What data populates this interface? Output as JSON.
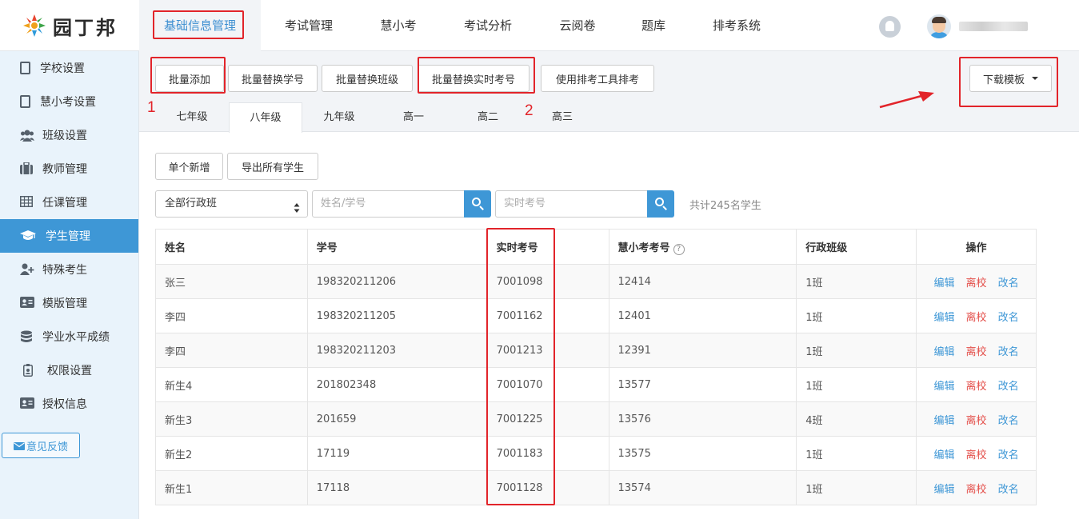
{
  "brand": {
    "name": "园丁邦"
  },
  "topnav": {
    "tabs": [
      {
        "label": "基础信息管理",
        "active": true
      },
      {
        "label": "考试管理"
      },
      {
        "label": "慧小考"
      },
      {
        "label": "考试分析"
      },
      {
        "label": "云阅卷"
      },
      {
        "label": "题库"
      },
      {
        "label": "排考系统"
      }
    ]
  },
  "sidebar": {
    "items": [
      {
        "label": "学校设置",
        "icon": "building-icon"
      },
      {
        "label": "慧小考设置",
        "icon": "building-icon"
      },
      {
        "label": "班级设置",
        "icon": "users-icon"
      },
      {
        "label": "教师管理",
        "icon": "briefcase-icon"
      },
      {
        "label": "任课管理",
        "icon": "table-icon"
      },
      {
        "label": "学生管理",
        "icon": "graduation-cap-icon",
        "active": true
      },
      {
        "label": "特殊考生",
        "icon": "user-plus-icon"
      },
      {
        "label": "模版管理",
        "icon": "id-card-icon"
      },
      {
        "label": "学业水平成绩",
        "icon": "database-icon"
      },
      {
        "label": "权限设置",
        "icon": "badge-icon"
      },
      {
        "label": "授权信息",
        "icon": "id-card-icon"
      }
    ],
    "feedback": "意见反馈"
  },
  "toolbar": {
    "batch_add": "批量添加",
    "batch_replace_student_no": "批量替换学号",
    "batch_replace_class": "批量替换班级",
    "batch_replace_exam_no": "批量替换实时考号",
    "use_tool": "使用排考工具排考",
    "download_template": "下载模板"
  },
  "annotations": {
    "n1": "1",
    "n2": "2"
  },
  "grades": [
    "七年级",
    "八年级",
    "九年级",
    "高一",
    "高二",
    "高三"
  ],
  "active_grade": "八年级",
  "actions": {
    "add_single": "单个新增",
    "export_all": "导出所有学生"
  },
  "filters": {
    "class_select": "全部行政班",
    "name_placeholder": "姓名/学号",
    "exam_no_placeholder": "实时考号",
    "total": "共计245名学生"
  },
  "table": {
    "headers": [
      "姓名",
      "学号",
      "实时考号",
      "慧小考考号",
      "行政班级",
      "操作"
    ],
    "rows": [
      {
        "name": "张三",
        "student_no": "198320211206",
        "exam_no": "7001098",
        "hx_no": "12414",
        "class": "1班"
      },
      {
        "name": "李四",
        "student_no": "198320211205",
        "exam_no": "7001162",
        "hx_no": "12401",
        "class": "1班"
      },
      {
        "name": "李四",
        "student_no": "198320211203",
        "exam_no": "7001213",
        "hx_no": "12391",
        "class": "1班"
      },
      {
        "name": "新生4",
        "student_no": "201802348",
        "exam_no": "7001070",
        "hx_no": "13577",
        "class": "1班"
      },
      {
        "name": "新生3",
        "student_no": "201659",
        "exam_no": "7001225",
        "hx_no": "13576",
        "class": "4班"
      },
      {
        "name": "新生2",
        "student_no": "17119",
        "exam_no": "7001183",
        "hx_no": "13575",
        "class": "1班"
      },
      {
        "name": "新生1",
        "student_no": "17118",
        "exam_no": "7001128",
        "hx_no": "13574",
        "class": "1班"
      }
    ],
    "ops": {
      "edit": "编辑",
      "leave": "离校",
      "rename": "改名"
    }
  }
}
